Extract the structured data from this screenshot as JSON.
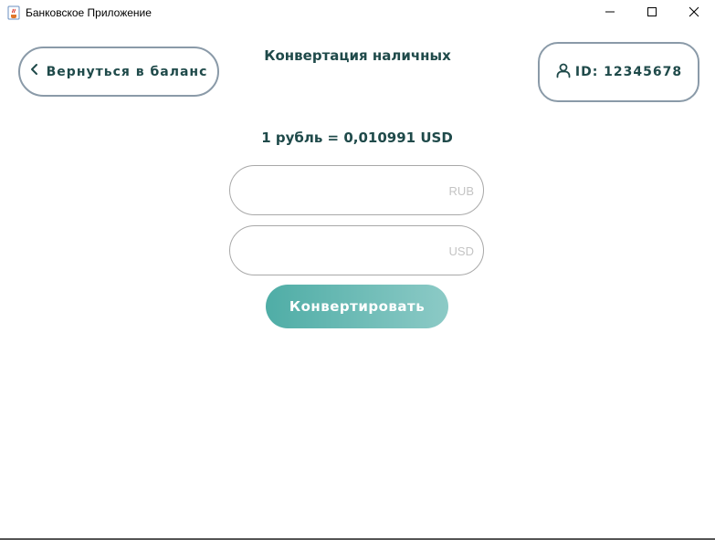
{
  "window": {
    "title": "Банковское Приложение",
    "icons": {
      "app": "java-cup-icon",
      "minimize": "minimize-icon",
      "maximize": "maximize-icon",
      "close": "close-icon"
    }
  },
  "header": {
    "back_label": "Вернуться в баланс",
    "back_icon": "chevron-left-icon",
    "title": "Конвертация наличных",
    "user_label": "ID: 12345678",
    "user_icon": "user-icon"
  },
  "main": {
    "rate": "1 рубль = 0,010991 USD",
    "rub_field": {
      "value": "",
      "currency": "RUB"
    },
    "usd_field": {
      "value": "",
      "currency": "USD"
    },
    "convert_label": "Конвертировать"
  },
  "colors": {
    "accent": "#1f4a4a",
    "button_gradient_start": "#4fada6",
    "button_gradient_end": "#8ccac6",
    "border": "#8a9aa8",
    "placeholder": "#c4c4c4"
  }
}
